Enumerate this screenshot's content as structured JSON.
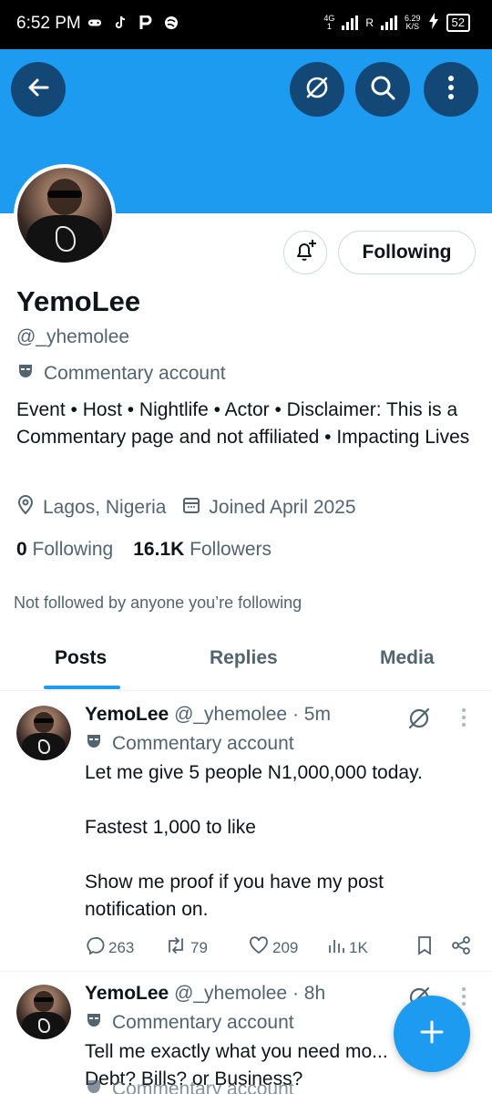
{
  "status_bar": {
    "time": "6:52 PM",
    "network_label_top": "4G",
    "network_label_bottom": "1",
    "roaming": "R",
    "speed_value": "6.29",
    "speed_unit": "K/S",
    "battery": "52",
    "app_icons": [
      "gamepad-icon",
      "tiktok-icon",
      "p-app-icon",
      "swirl-app-icon"
    ]
  },
  "header": {
    "back_icon": "back-arrow-icon",
    "grok_icon": "grok-icon",
    "search_icon": "search-icon",
    "more_icon": "more-vertical-icon",
    "banner_color": "#1d9bf0"
  },
  "profile": {
    "name": "YemoLee",
    "handle": "@_yhemolee",
    "commentary_label": "Commentary account",
    "bio": "Event • Host • Nightlife • Actor • Disclaimer: This is a Commentary page and not affiliated • Impacting Lives",
    "location": "Lagos, Nigeria",
    "joined": "Joined April 2025",
    "following_count": "0",
    "following_label": "Following",
    "followers_count": "16.1K",
    "followers_label": "Followers",
    "not_followed": "Not followed by anyone you’re following",
    "follow_button": "Following"
  },
  "tabs": [
    {
      "label": "Posts",
      "active": true
    },
    {
      "label": "Replies",
      "active": false
    },
    {
      "label": "Media",
      "active": false
    }
  ],
  "posts": [
    {
      "name": "YemoLee",
      "handle_time": "@_yhemolee · 5m",
      "commentary_label": "Commentary account",
      "text": "Let me give 5 people N1,000,000 today.\n\nFastest 1,000 to like\n\nShow me proof if you have my post notification on.",
      "replies": "263",
      "reposts": "79",
      "likes": "209",
      "views": "1K"
    },
    {
      "name": "YemoLee",
      "handle_time": "@_yhemolee · 8h",
      "commentary_label": "Commentary account",
      "text": "Tell me exactly what you need mo...\nDebt? Bills? or Business?"
    }
  ],
  "third_post_peek": {
    "commentary_label": "Commentary account"
  },
  "fab": {
    "icon": "plus-icon"
  }
}
